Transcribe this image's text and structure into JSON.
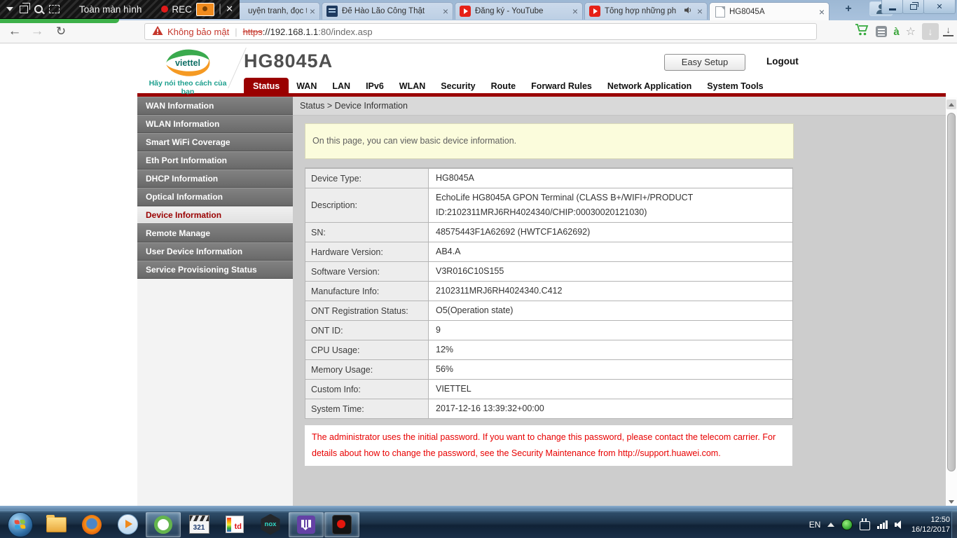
{
  "recorder": {
    "title": "Toàn màn hình",
    "rec_label": "REC"
  },
  "browser": {
    "tabs": [
      {
        "title": "uyện tranh, đọc t",
        "favicon": "none"
      },
      {
        "title": "Đế Hào Lão Công Thật",
        "favicon": "navy"
      },
      {
        "title": "Đăng ký - YouTube",
        "favicon": "youtube"
      },
      {
        "title": "Tổng hợp những ph",
        "favicon": "youtube",
        "audio": true
      },
      {
        "title": "HG8045A",
        "favicon": "page",
        "active": true
      }
    ],
    "address": {
      "security_warning": "Không bảo mật",
      "scheme": "https",
      "host": "://192.168.1.1",
      "suffix": ":80/index.asp"
    }
  },
  "app": {
    "logo_text": "viettel",
    "tagline": "Hãy nói theo cách của bạn",
    "model": "HG8045A",
    "easy_setup_label": "Easy Setup",
    "logout_label": "Logout",
    "nav": [
      {
        "label": "Status",
        "active": true
      },
      {
        "label": "WAN"
      },
      {
        "label": "LAN"
      },
      {
        "label": "IPv6"
      },
      {
        "label": "WLAN"
      },
      {
        "label": "Security"
      },
      {
        "label": "Route"
      },
      {
        "label": "Forward Rules"
      },
      {
        "label": "Network Application"
      },
      {
        "label": "System Tools"
      }
    ],
    "sidebar": [
      {
        "label": "WAN Information"
      },
      {
        "label": "WLAN Information"
      },
      {
        "label": "Smart WiFi Coverage"
      },
      {
        "label": "Eth Port Information"
      },
      {
        "label": "DHCP Information"
      },
      {
        "label": "Optical Information"
      },
      {
        "label": "Device Information",
        "active": true
      },
      {
        "label": "Remote Manage"
      },
      {
        "label": "User Device Information"
      },
      {
        "label": "Service Provisioning Status"
      }
    ],
    "breadcrumb": "Status > Device Information",
    "note": "On this page, you can view basic device information.",
    "device_table": [
      {
        "label": "Device Type:",
        "value": "HG8045A"
      },
      {
        "label": "Description:",
        "value": "EchoLife HG8045A GPON Terminal (CLASS B+/WIFI+/PRODUCT ID:2102311MRJ6RH4024340/CHIP:00030020121030)"
      },
      {
        "label": "SN:",
        "value": "48575443F1A62692 (HWTCF1A62692)"
      },
      {
        "label": "Hardware Version:",
        "value": "AB4.A"
      },
      {
        "label": "Software Version:",
        "value": "V3R016C10S155"
      },
      {
        "label": "Manufacture Info:",
        "value": "2102311MRJ6RH4024340.C412"
      },
      {
        "label": "ONT Registration Status:",
        "value": "O5(Operation state)"
      },
      {
        "label": "ONT ID:",
        "value": "9"
      },
      {
        "label": "CPU Usage:",
        "value": "12%"
      },
      {
        "label": "Memory Usage:",
        "value": "56%"
      },
      {
        "label": "Custom Info:",
        "value": "VIETTEL"
      },
      {
        "label": "System Time:",
        "value": "2017-12-16 13:39:32+00:00"
      }
    ],
    "warning": "The administrator uses the initial password. If you want to change this password, please contact the telecom carrier. For details about how to change the password, see the Security Maintenance from http://support.huawei.com."
  },
  "taskbar": {
    "icon_names": [
      "start",
      "file-explorer",
      "firefox",
      "windows-media-player",
      "coccoc-browser",
      "mpc-hc",
      "mtd-player",
      "nox-emulator",
      "twitch",
      "screen-recorder"
    ],
    "mpc_label": "321",
    "nox_label": "nox",
    "mtd_label": "td",
    "tray": {
      "lang": "EN",
      "time": "12:50",
      "date": "16/12/2017"
    }
  },
  "colors": {
    "brand_red": "#9a0000",
    "warning_text_red": "#e80000",
    "omnibox_warning_red": "#c5372c",
    "note_yellow": "#fbfcdc",
    "tabstrip_blue": "#a9c2dd",
    "taskbar_blue": "#1d3349",
    "viettel_green": "#3aaa4e",
    "viettel_orange": "#f59a23"
  }
}
